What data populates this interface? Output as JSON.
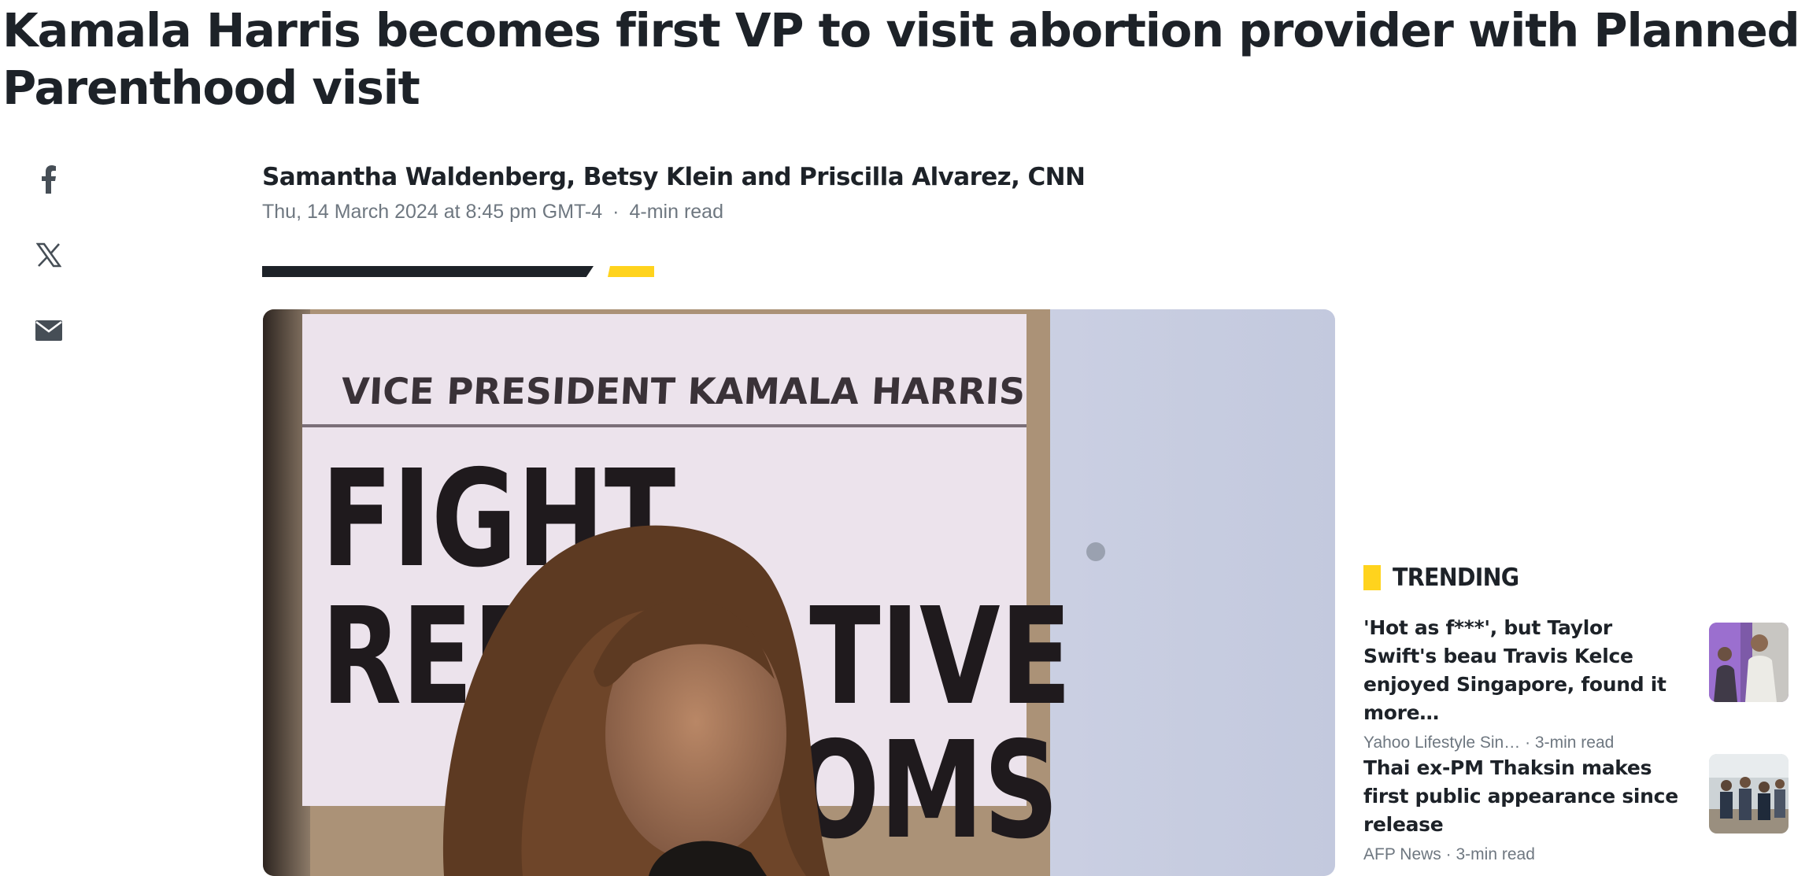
{
  "article": {
    "headline": "Kamala Harris becomes first VP to visit abortion provider with Planned Parenthood visit",
    "authors": "Samantha Waldenberg, Betsy Klein and Priscilla Alvarez, CNN",
    "date": "Thu, 14 March 2024 at 8:45 pm GMT-4",
    "separator": "·",
    "read_time": "4-min read",
    "hero_image": {
      "sign_line1": "VICE PRESIDENT KAMALA HARRIS",
      "sign_line2": "FIGHT",
      "sign_line3a": "REP",
      "sign_line3b": "TIVE",
      "sign_line4": "OMS"
    }
  },
  "share": {
    "icons": [
      "facebook-icon",
      "x-icon",
      "mail-icon"
    ]
  },
  "trending": {
    "title": "TRENDING",
    "items": [
      {
        "headline": "'Hot as f***', but Taylor Swift's beau Travis Kelce enjoyed Singapore, found it more…",
        "source": "Yahoo Lifestyle Sin…",
        "separator": "·",
        "read_time": "3-min read"
      },
      {
        "headline": "Thai ex-PM Thaksin makes first public appearance since release",
        "source": "AFP News",
        "separator": "·",
        "read_time": "3-min read"
      }
    ]
  },
  "colors": {
    "accent": "#ffd31d",
    "text": "#1d2228",
    "muted": "#6e7780"
  }
}
